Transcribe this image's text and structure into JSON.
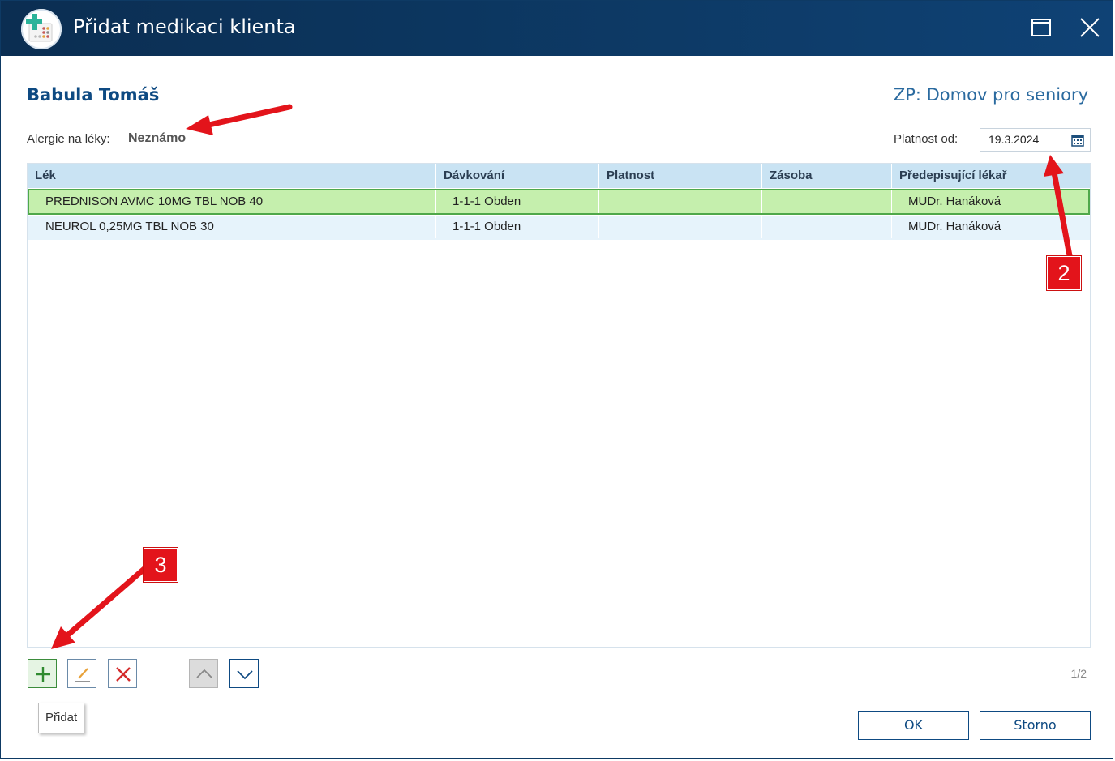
{
  "window": {
    "title": "Přidat medikaci klienta"
  },
  "client": {
    "name": "Babula Tomáš",
    "zp": "ZP: Domov pro seniory"
  },
  "allergy": {
    "label": "Alergie na léky:",
    "value": "Neznámo"
  },
  "validity": {
    "label": "Platnost od:",
    "date": "19.3.2024"
  },
  "grid": {
    "columns": [
      "Lék",
      "Dávkování",
      "Platnost",
      "Zásoba",
      "Předepisující lékař"
    ],
    "rows": [
      {
        "lek": "PREDNISON AVMC 10MG TBL NOB 40",
        "davkovani": "1-1-1 Obden",
        "platnost": "",
        "zasoba": "",
        "lekar": "MUDr. Hanáková"
      },
      {
        "lek": "NEUROL 0,25MG TBL NOB 30",
        "davkovani": "1-1-1 Obden",
        "platnost": "",
        "zasoba": "",
        "lekar": "MUDr. Hanáková"
      }
    ]
  },
  "toolbar": {
    "tooltip": "Přidat",
    "pager": "1/2"
  },
  "buttons": {
    "ok": "OK",
    "storno": "Storno"
  },
  "annotations": {
    "badge2": "2",
    "badge3": "3"
  },
  "colors": {
    "titlebar": "#0d3a66",
    "selected_row": "#c5efad",
    "header": "#c9e3f3",
    "badge": "#e3141b"
  }
}
